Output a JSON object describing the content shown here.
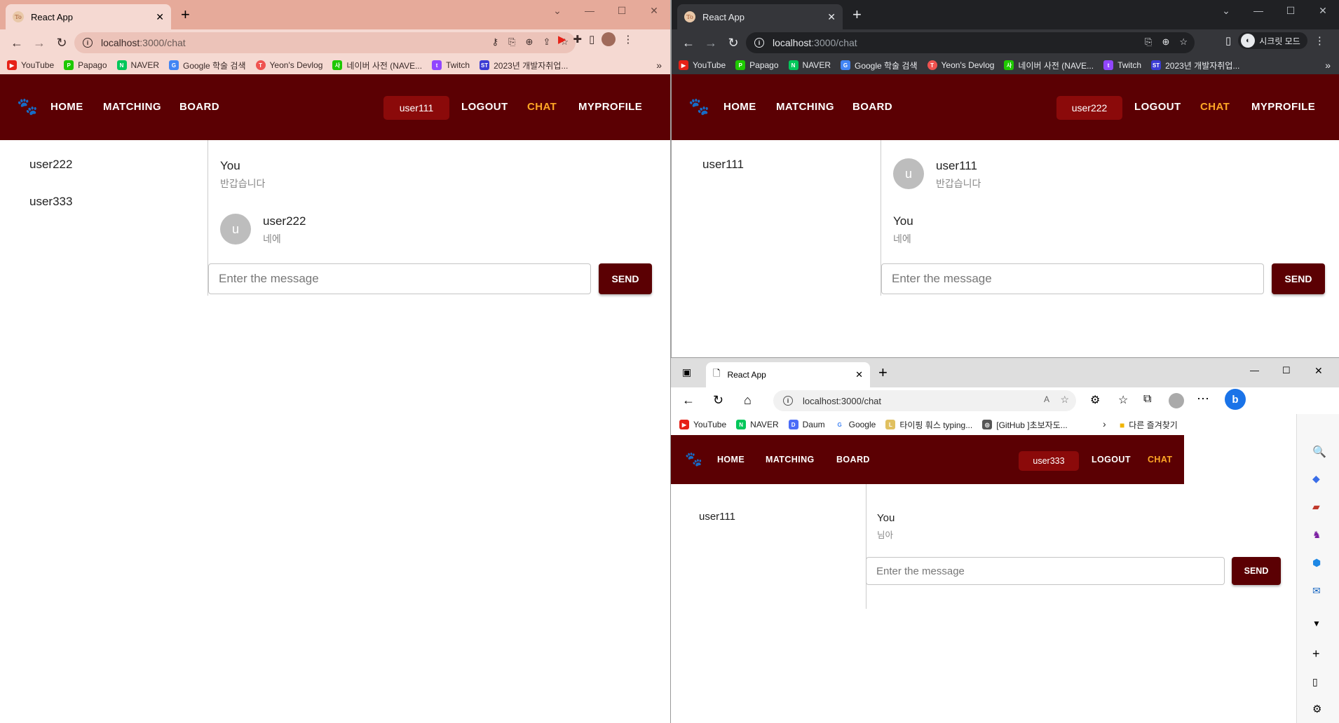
{
  "bookmarks_chrome": [
    "YouTube",
    "Papago",
    "NAVER",
    "Google 학술 검색",
    "Yeon's Devlog",
    "네이버 사전 (NAVE...",
    "Twitch",
    "2023년 개발자취업..."
  ],
  "bookmarks_edge": [
    "YouTube",
    "NAVER",
    "Daum",
    "Google",
    "타이핑 훠스 typing...",
    "[GitHub ]초보자도...",
    "다른 즐겨찾기"
  ],
  "nav": {
    "home": "HOME",
    "matching": "MATCHING",
    "board": "BOARD",
    "logout": "LOGOUT",
    "chat": "CHAT",
    "myprofile": "MYPROFILE"
  },
  "input_placeholder": "Enter the message",
  "send_label": "SEND",
  "win1": {
    "tab_title": "React App",
    "url_prefix": "localhost",
    "url_rest": ":3000/chat",
    "user": "user111",
    "contacts": [
      "user222",
      "user333"
    ],
    "messages": [
      {
        "name": "You",
        "text": "반갑습니다",
        "avatar": ""
      },
      {
        "name": "user222",
        "text": "네에",
        "avatar": "u"
      }
    ]
  },
  "win2": {
    "tab_title": "React App",
    "url_prefix": "localhost",
    "url_rest": ":3000/chat",
    "profile_label": "시크릿 모드",
    "user": "user222",
    "contacts": [
      "user111"
    ],
    "messages": [
      {
        "name": "user111",
        "text": "반갑습니다",
        "avatar": "u"
      },
      {
        "name": "You",
        "text": "네에",
        "avatar": ""
      }
    ]
  },
  "win3": {
    "tab_title": "React App",
    "url": "localhost:3000/chat",
    "user": "user333",
    "contacts": [
      "user111"
    ],
    "messages": [
      {
        "name": "You",
        "text": "님아"
      }
    ]
  },
  "colors": {
    "nav_bg": "#5b0003",
    "chat_accent": "#ffa726",
    "user_badge": "#8b0a0a",
    "chrome1_frame": "#e8aea0",
    "chrome2_frame": "#202124"
  }
}
